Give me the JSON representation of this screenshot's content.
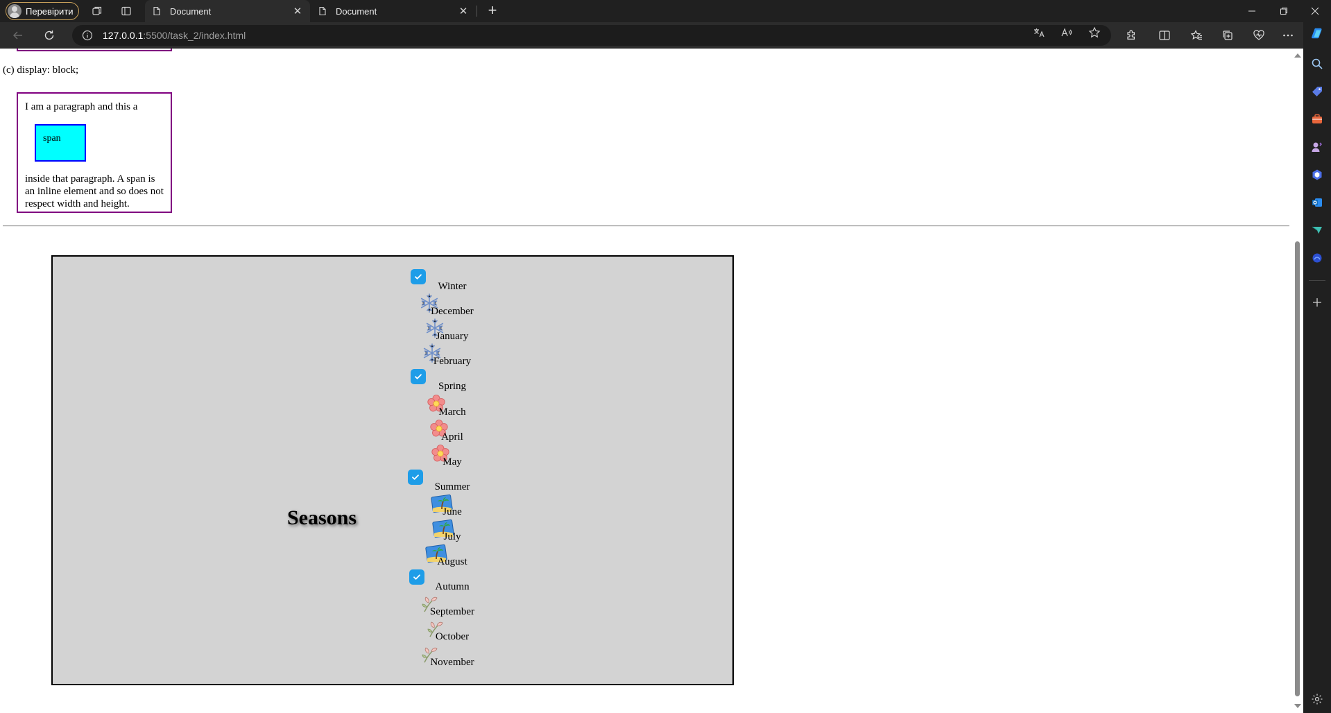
{
  "browser": {
    "profile_label": "Перевірити",
    "tabs": [
      {
        "title": "Document",
        "active": true
      },
      {
        "title": "Document",
        "active": false
      }
    ],
    "url_host": "127.0.0.1",
    "url_path": ":5500/task_2/index.html"
  },
  "page": {
    "caption_c": "(c) display: block;",
    "demo_text_before": "I am a paragraph and this a",
    "demo_span_text": "span",
    "demo_text_after": "inside that paragraph. A span is an inline element and so does not respect width and height.",
    "seasons_title": "Seasons",
    "seasons": [
      {
        "name": "Winter",
        "icon": "snowflake-icon",
        "months": [
          "December",
          "January",
          "February"
        ]
      },
      {
        "name": "Spring",
        "icon": "flower-icon",
        "months": [
          "March",
          "April",
          "May"
        ]
      },
      {
        "name": "Summer",
        "icon": "palm-beach-icon",
        "months": [
          "June",
          "July",
          "August"
        ]
      },
      {
        "name": "Autumn",
        "icon": "autumn-branch-icon",
        "months": [
          "September",
          "October",
          "November"
        ]
      }
    ]
  },
  "colors": {
    "checkbox": "#1e9de8",
    "box_border": "#800080",
    "span_bg": "#00ffff",
    "span_border": "#0000ff",
    "seasons_bg": "#d3d3d3"
  }
}
